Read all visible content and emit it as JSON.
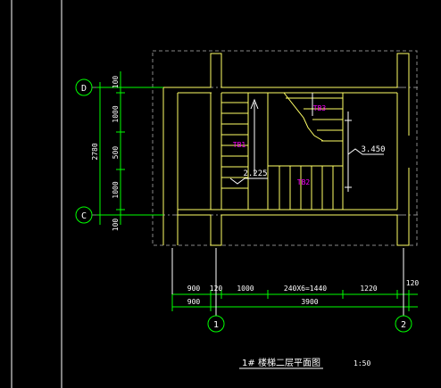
{
  "drawing": {
    "title": "1# 楼梯二层平面图",
    "scale": "1:50",
    "grid_axes": {
      "D": "D",
      "C": "C",
      "one": "1",
      "two": "2"
    },
    "left_dims": {
      "total": "2780",
      "d100_top": "100",
      "d1000_a": "1000",
      "d500": "500",
      "d1000_b": "1000",
      "d100_bot": "100"
    },
    "bottom_row1": {
      "a": "900",
      "b": "120",
      "c": "1000",
      "d": "240X6=1440",
      "e": "1220",
      "f": "120"
    },
    "bottom_row2": {
      "a": "900",
      "b": "3900"
    },
    "stair_labels": {
      "tb1": "TB1",
      "tb2": "TB2",
      "tb3": "TB3"
    },
    "elevations": {
      "lower": "2.225",
      "upper": "3.450"
    }
  },
  "colors": {
    "background": "#000000",
    "wall": "#ffff66",
    "dimension": "#00ff00",
    "grid": "#ffffff",
    "stair_tag": "#ff00ff",
    "axis_circle": "#00ff00"
  }
}
